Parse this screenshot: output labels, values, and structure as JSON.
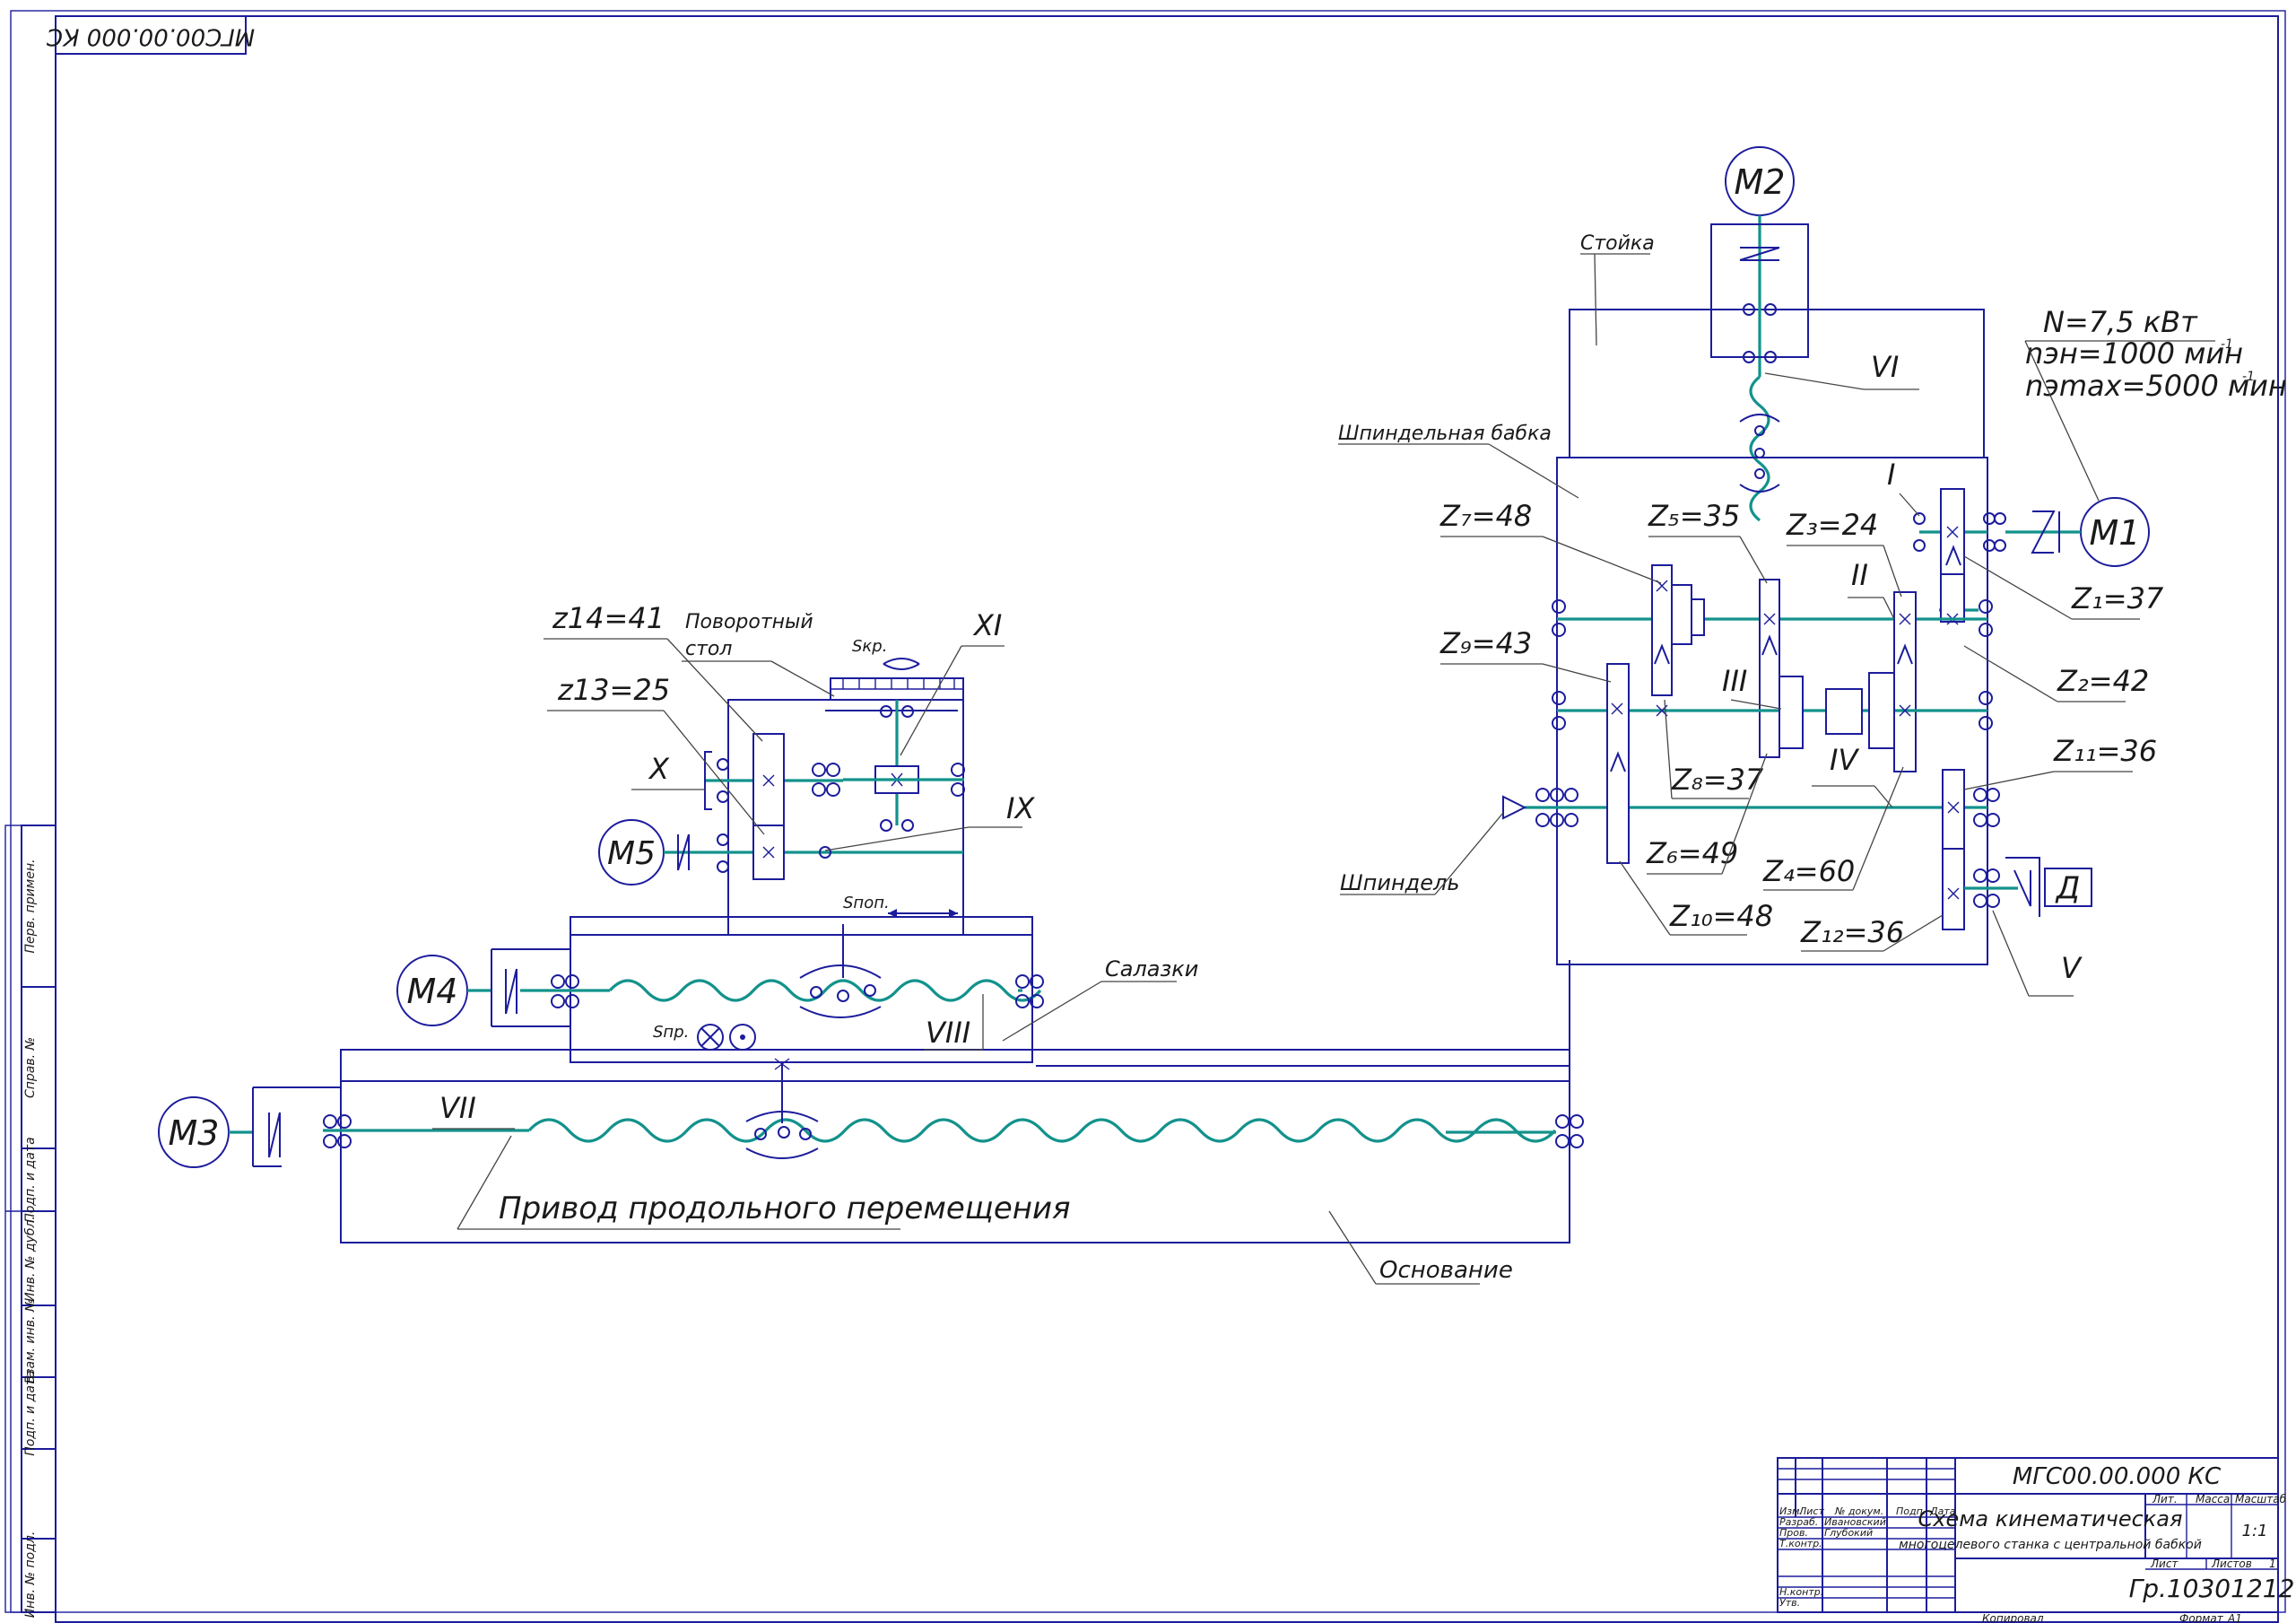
{
  "stamp_top": "МГС00.00.000 КС",
  "labels": {
    "M1": "M1",
    "M2": "M2",
    "M3": "M3",
    "M4": "M4",
    "M5": "M5",
    "D": "Д",
    "stoika": "Стойка",
    "shpindelnaya_babka": "Шпиндельная бабка",
    "power_n": "N=7,5 кВт",
    "power_nn": "nэн=1000 мин",
    "power_nmax": "nэmax=5000 мин",
    "power_exp": "-1",
    "shpindel": "Шпиндель",
    "salazki": "Салазки",
    "osnovanie": "Основание",
    "privod": "Привод продольного перемещения",
    "povorotny": "Поворотный",
    "stol": "стол",
    "s_kr": "Sкр.",
    "s_pop": "Sпоп.",
    "s_pr": "Sпр."
  },
  "gears": {
    "z1": "Z₁=37",
    "z2": "Z₂=42",
    "z3": "Z₃=24",
    "z4": "Z₄=60",
    "z5": "Z₅=35",
    "z6": "Z₆=49",
    "z7": "Z₇=48",
    "z8": "Z₈=37",
    "z9": "Z₉=43",
    "z10": "Z₁₀=48",
    "z11": "Z₁₁=36",
    "z12": "Z₁₂=36",
    "z13": "z13=25",
    "z14": "z14=41"
  },
  "shafts": {
    "I": "I",
    "II": "II",
    "III": "III",
    "IV": "IV",
    "V": "V",
    "VI": "VI",
    "VII": "VII",
    "VIII": "VIII",
    "IX": "IX",
    "X": "X",
    "XI": "XI"
  },
  "side_strip": [
    "Перв. примен.",
    "Справ. №",
    "Подп. и дата",
    "Инв. № дубл.",
    "Взам. инв. №",
    "Подп. и дата",
    "Инв. № подл."
  ],
  "title_block": {
    "designation": "МГС00.00.000 КС",
    "title_line1": "Схема кинематическая",
    "title_line2": "многоцелевого станка с центральной бабкой",
    "col_izm": "Изм.",
    "col_list": "Лист",
    "col_doc": "№ докум.",
    "col_podp": "Подп.",
    "col_data": "Дата",
    "razrab": "Разраб.",
    "razrab_name": "Ивановский",
    "prov": "Пров.",
    "prov_name": "Глубокий",
    "tkontr": "Т.контр.",
    "nkontr": "Н.контр.",
    "utv": "Утв.",
    "lit": "Лит.",
    "massa": "Масса",
    "masshtab": "Масштаб",
    "scale_value": "1:1",
    "list": "Лист",
    "listov": "Листов",
    "listov_value": "1",
    "group": "Гр.10301212",
    "kopiroval": "Копировал",
    "format": "Формат",
    "format_value": "A1"
  }
}
